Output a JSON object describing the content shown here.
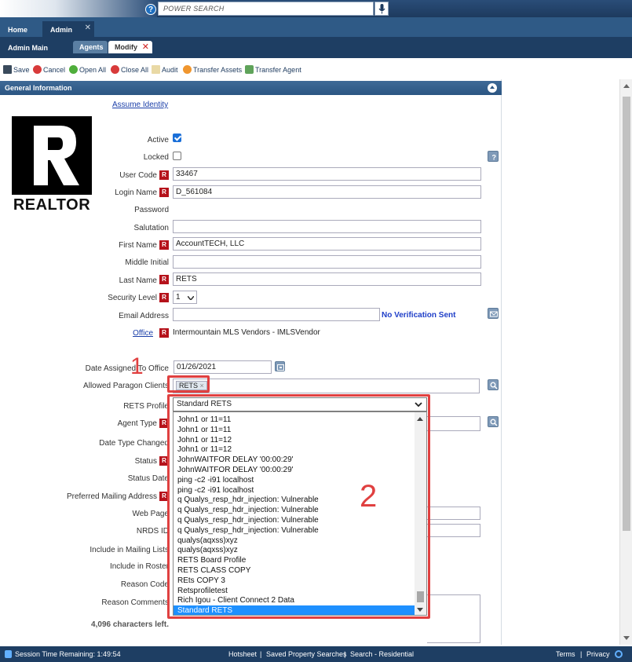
{
  "header": {
    "search_placeholder": "POWER SEARCH",
    "help_label": "?"
  },
  "tabs": {
    "home": "Home",
    "admin": "Admin",
    "close_glyph": "✕"
  },
  "subheader": {
    "title": "Admin Main",
    "agents": "Agents",
    "modify": "Modify",
    "close_glyph": "✕"
  },
  "toolbar": {
    "save": "Save",
    "cancel": "Cancel",
    "open_all": "Open All",
    "close_all": "Close All",
    "audit": "Audit",
    "transfer_assets": "Transfer Assets",
    "transfer_agent": "Transfer Agent"
  },
  "panel": {
    "title": "General Information",
    "assume_identity": "Assume Identity",
    "logo_text": "REALTOR"
  },
  "fields": {
    "active": "Active",
    "locked": "Locked",
    "user_code": "User Code",
    "user_code_value": "33467",
    "login_name": "Login Name",
    "login_name_value": "D_561084",
    "password": "Password",
    "salutation": "Salutation",
    "first_name": "First Name",
    "first_name_value": "AccountTECH, LLC",
    "middle_initial": "Middle Initial",
    "last_name": "Last Name",
    "last_name_value": "RETS",
    "security_level": "Security Level",
    "security_level_value": "1",
    "email_address": "Email Address",
    "no_verification": "No Verification Sent",
    "office": "Office",
    "office_value": "Intermountain MLS Vendors - IMLSVendor",
    "date_assigned": "Date Assigned To Office",
    "date_assigned_value": "01/26/2021",
    "allowed_clients": "Allowed Paragon Clients",
    "allowed_clients_chip": "RETS",
    "rets_profile": "RETS Profile",
    "rets_profile_value": "Standard RETS",
    "agent_type": "Agent Type",
    "date_type_changed": "Date Type Changed",
    "status": "Status",
    "status_date": "Status Date",
    "preferred_mailing": "Preferred Mailing Address",
    "web_page": "Web Page",
    "nrds_id": "NRDS ID",
    "include_mailing": "Include in Mailing Lists",
    "include_roster": "Include in Roster",
    "reason_code": "Reason Code",
    "reason_comments": "Reason Comments",
    "chars_left": "4,096 characters left.",
    "required_glyph": "R"
  },
  "dropdown_options": [
    "John1 or 11=11",
    "John1 or 11=11",
    "John1 or 11=12",
    "John1 or 11=12",
    "JohnWAITFOR DELAY '00:00:29'",
    "JohnWAITFOR DELAY '00:00:29'",
    "ping -c2 -i91 localhost",
    "ping -c2 -i91 localhost",
    "q Qualys_resp_hdr_injection: Vulnerable",
    "q Qualys_resp_hdr_injection: Vulnerable",
    "q Qualys_resp_hdr_injection: Vulnerable",
    "q Qualys_resp_hdr_injection: Vulnerable",
    "qualys(aqxss)xyz",
    "qualys(aqxss)xyz",
    "RETS Board Profile",
    "RETS CLASS COPY",
    "REts COPY 3",
    "Retsprofiletest",
    "Rich Igou - Client Connect 2 Data",
    "Standard RETS"
  ],
  "annotations": {
    "one": "1",
    "two": "2"
  },
  "statusbar": {
    "session": "Session Time Remaining: 1:49:54",
    "hotsheet": "Hotsheet",
    "saved_searches": "Saved Property Searches",
    "search_residential": "Search - Residential",
    "terms": "Terms",
    "privacy": "Privacy",
    "sep": "|"
  },
  "colors": {
    "nav_dark": "#1e3e63",
    "required_red": "#b5121b",
    "annotation_red": "#e04040",
    "selected_blue": "#1e90ff"
  }
}
